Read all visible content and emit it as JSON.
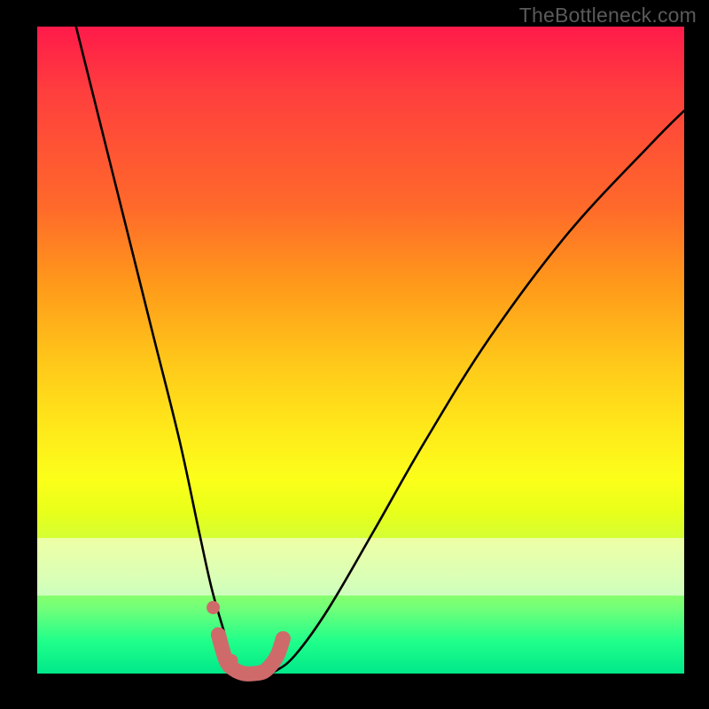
{
  "watermark": "TheBottleneck.com",
  "chart_data": {
    "type": "line",
    "title": "",
    "xlabel": "",
    "ylabel": "",
    "xlim": [
      0,
      100
    ],
    "ylim": [
      0,
      100
    ],
    "grid": false,
    "legend": false,
    "series": [
      {
        "name": "bottleneck-curve",
        "x": [
          6,
          10,
          14,
          18,
          22,
          25,
          27,
          29,
          30,
          31,
          33,
          35,
          37,
          40,
          45,
          52,
          60,
          70,
          82,
          95,
          100
        ],
        "values": [
          100,
          84,
          68,
          52,
          36,
          22,
          13,
          6,
          2,
          0.5,
          0,
          0,
          0.5,
          3,
          10,
          22,
          36,
          52,
          68,
          82,
          87
        ]
      }
    ],
    "markers": [
      {
        "name": "dot-left",
        "x": 27.2,
        "y": 10.2
      },
      {
        "name": "dot-valley",
        "x": 30.0,
        "y": 2.0
      }
    ],
    "highlight_segment": {
      "name": "valley-highlight",
      "x": [
        28.0,
        29.2,
        30.5,
        32.0,
        33.5,
        35.0,
        36.2,
        37.2,
        38.0
      ],
      "values": [
        6.0,
        2.0,
        0.6,
        0.0,
        0.0,
        0.3,
        1.4,
        3.0,
        5.4
      ]
    },
    "pale_band_y": [
      12,
      21
    ],
    "colors": {
      "curve": "#000000",
      "highlight": "#cf6a6a",
      "watermark": "#5a5a5a"
    }
  }
}
